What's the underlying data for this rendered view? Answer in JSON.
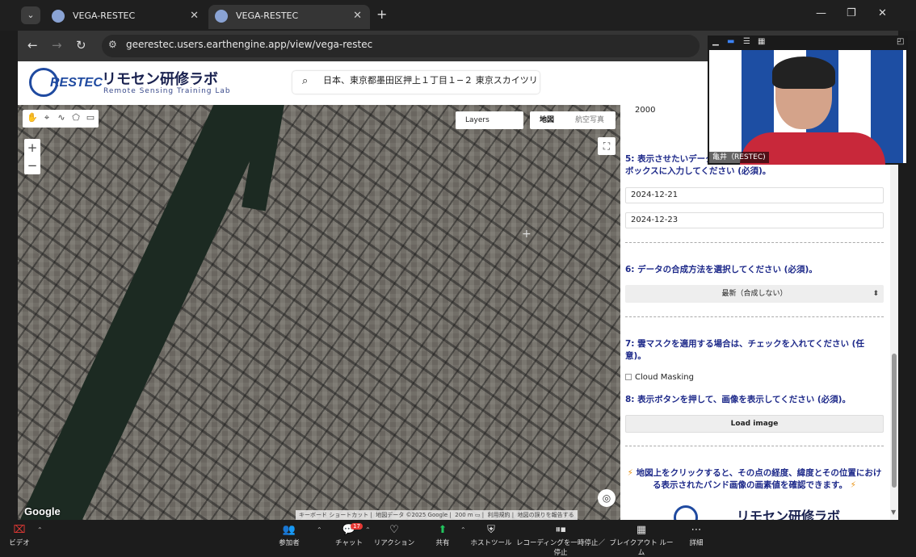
{
  "browser": {
    "tabs": [
      {
        "label": "VEGA-RESTEC"
      },
      {
        "label": "VEGA-RESTEC"
      }
    ],
    "new_tab": "+",
    "url": "geerestec.users.earthengine.app/view/vega-restec",
    "window_controls": {
      "minimize": "—",
      "maximize": "❐",
      "close": "✕"
    }
  },
  "header": {
    "logo_text": "RESTEC",
    "title": "リモセン研修ラボ",
    "subtitle": "Remote Sensing Training Lab",
    "search_value": "日本、東京都墨田区押上１丁目１−２ 東京スカイツリー"
  },
  "map": {
    "layers_label": "Layers",
    "map_type": {
      "map": "地図",
      "satellite": "航空写真"
    },
    "zoom_in": "+",
    "zoom_out": "−",
    "google_logo": "Google",
    "attribution": {
      "shortcuts": "キーボード ショートカット",
      "data": "地図データ ©2025 Google",
      "scale": "200 m",
      "terms": "利用規約",
      "report": "地図の誤りを報告する"
    }
  },
  "panel": {
    "year_value": "2000",
    "step5_label": "5: 表示させたいデータの期間を、2024-01-01のようにテキストボックスに入力してください (必須)。",
    "start_date": "2024-12-21",
    "end_date": "2024-12-23",
    "step6_label": "6: データの合成方法を選択してください (必須)。",
    "composite_selected": "最新（合成しない）",
    "step7_label": "7: 雲マスクを適用する場合は、チェックを入れてください (任意)。",
    "cloud_masking_label": "Cloud Masking",
    "step8_label": "8: 表示ボタンを押して、画像を表示してください (必須)。",
    "load_button": "Load image",
    "info_text": "地図上をクリックすると、その点の経度、緯度とその位置における表示されたバンド画像の画素値を確認できます。",
    "footer_title": "リモセン研修ラボ"
  },
  "video": {
    "participant_name": "亀井（RESTEC)"
  },
  "zoom_toolbar": {
    "video": "ビデオ",
    "participants": "参加者",
    "chat": "チャット",
    "chat_badge": "17",
    "reactions": "リアクション",
    "share": "共有",
    "host_tools": "ホストツール",
    "recording": "レコーディングを一時停止／停止",
    "breakout": "ブレイクアウト ルーム",
    "more": "詳細"
  }
}
